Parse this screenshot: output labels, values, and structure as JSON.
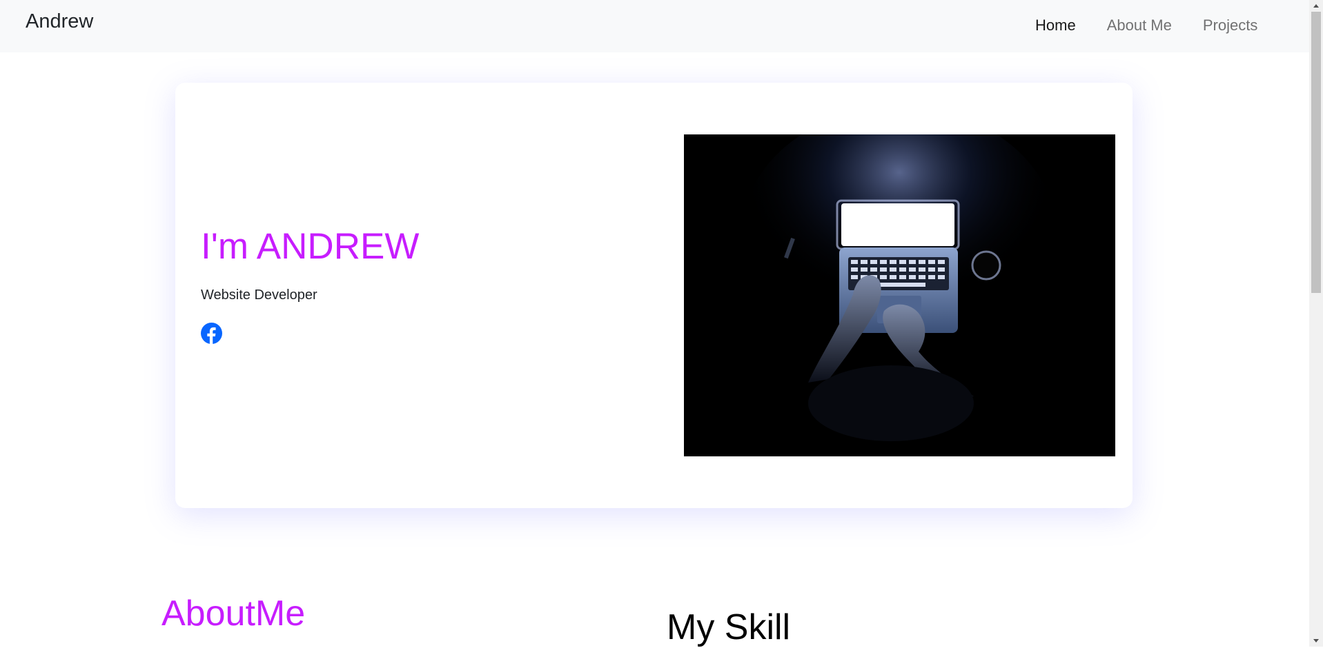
{
  "navbar": {
    "brand": "Andrew",
    "links": [
      {
        "label": "Home"
      },
      {
        "label": "About Me"
      },
      {
        "label": "Projects"
      }
    ]
  },
  "hero": {
    "title": "I'm ANDREW",
    "subtitle": "Website Developer",
    "social_icon": "facebook-icon",
    "image_alt": "Person typing on a glowing laptop in the dark"
  },
  "about": {
    "title": "AboutMe"
  },
  "skills": {
    "title": "My Skill"
  },
  "colors": {
    "accent": "#c71dfe",
    "navbar_bg": "#f8f9fa",
    "facebook_blue": "#0866ff"
  }
}
